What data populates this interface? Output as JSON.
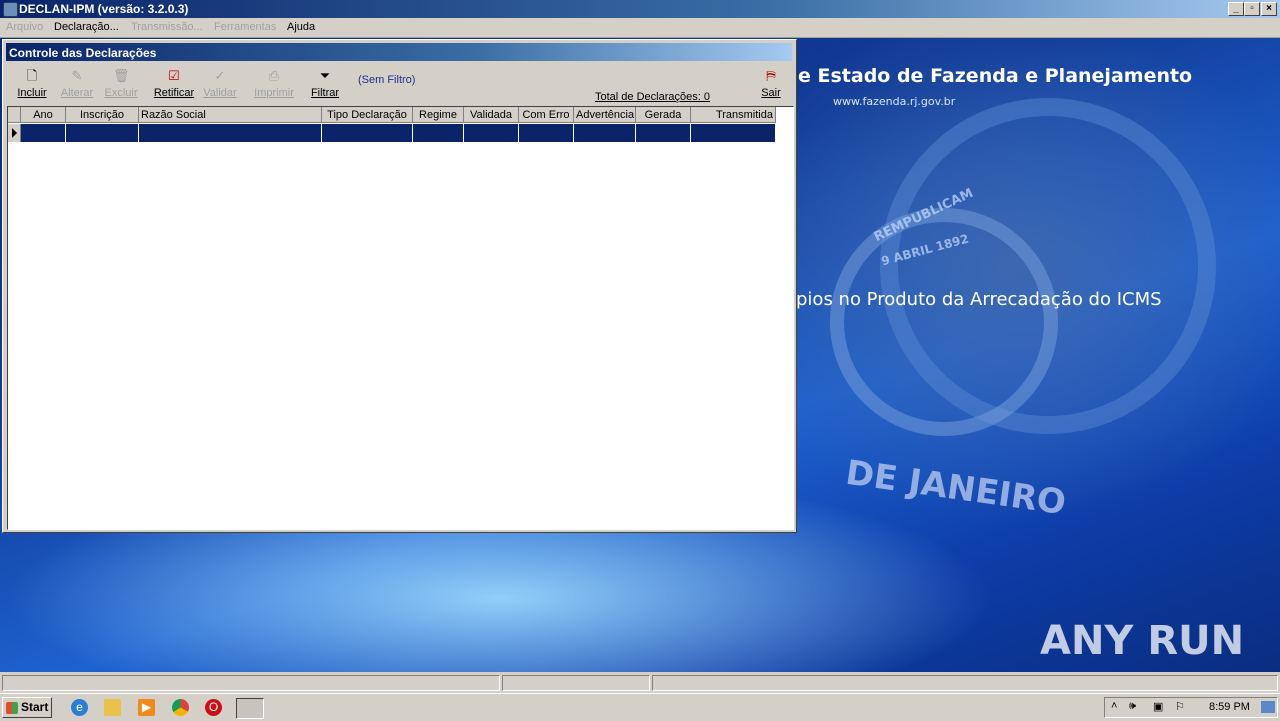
{
  "window": {
    "title": "DECLAN-IPM (versão: 3.2.0.3)"
  },
  "menu": [
    {
      "label": "Arquivo",
      "enabled": false
    },
    {
      "label": "Declaração...",
      "enabled": true
    },
    {
      "label": "Transmissão...",
      "enabled": false
    },
    {
      "label": "Ferramentas",
      "enabled": false
    },
    {
      "label": "Ajuda",
      "enabled": true
    }
  ],
  "background": {
    "headline": "e Estado de Fazenda e Planejamento",
    "url": "www.fazenda.rj.gov.br",
    "subtitle": "pios no Produto da Arrecadação do ICMS",
    "seal_text_1": "REMPUBLICAM",
    "seal_text_2": "9 ABRIL 1892",
    "seal_text_3": "DE JANEIRO",
    "watermark": "ANY RUN"
  },
  "child_window": {
    "title": "Controle das Declarações",
    "filter_status": "(Sem Filtro)",
    "total_label": "Total de Declarações: 0"
  },
  "toolbar": {
    "incluir": "Incluir",
    "alterar": "Alterar",
    "excluir": "Excluir",
    "retificar": "Retificar",
    "validar": "Validar",
    "imprimir": "Imprimir",
    "filtrar": "Filtrar",
    "sair": "Sair"
  },
  "grid": {
    "columns": [
      "Ano",
      "Inscrição",
      "Razão Social",
      "Tipo Declaração",
      "Regime",
      "Validada",
      "Com Erro",
      "Advertência",
      "Gerada",
      "Transmitida"
    ],
    "rows": []
  },
  "taskbar": {
    "start_label": "Start",
    "clock": "8:59 PM"
  },
  "colors": {
    "titlebar_start": "#0a246a",
    "selection": "#0a246a",
    "desktop_blue": "#113c98"
  }
}
